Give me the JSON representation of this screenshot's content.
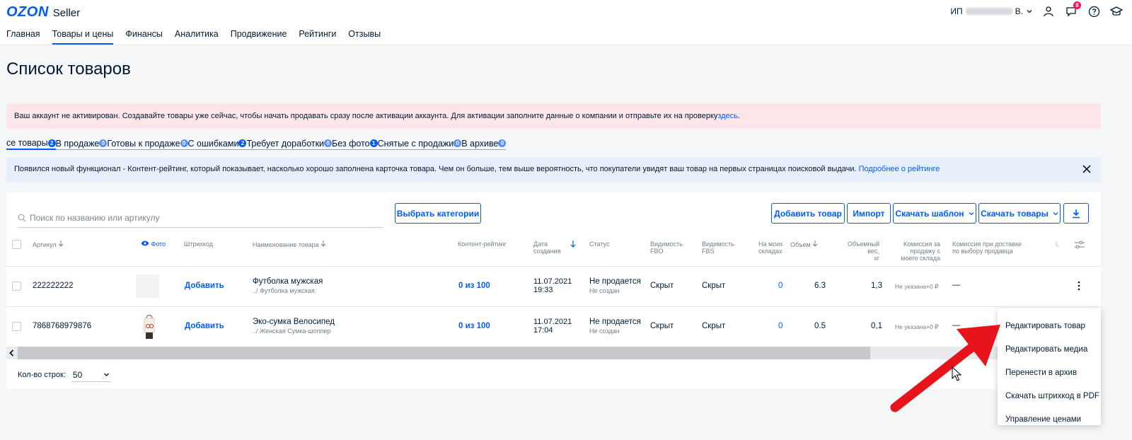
{
  "header": {
    "logo_brand": "OZON",
    "logo_product": "Seller",
    "account_prefix": "ИП",
    "account_suffix": "В.",
    "notifications_count": "8",
    "nav": [
      "Главная",
      "Товары и цены",
      "Финансы",
      "Аналитика",
      "Продвижение",
      "Рейтинги",
      "Отзывы"
    ]
  },
  "page_title": "Список товаров",
  "alert_activation": {
    "text": "Ваш аккаунт не активирован. Создавайте товары уже сейчас, чтобы начать продавать сразу после активации аккаунта. Для активации заполните данные о компании и отправьте их на проверку",
    "link": "здесь",
    "after": "."
  },
  "filter_tabs": [
    {
      "label": "се товары",
      "count": "2"
    },
    {
      "label": "В продаже",
      "count": "0"
    },
    {
      "label": "Готовы к продаже",
      "count": "0"
    },
    {
      "label": "С ошибками",
      "count": "2"
    },
    {
      "label": "Требует доработки",
      "count": "0"
    },
    {
      "label": "Без фото",
      "count": "1"
    },
    {
      "label": "Снятые с продажи",
      "count": "0"
    },
    {
      "label": "В архиве",
      "count": "0"
    }
  ],
  "alert_info": {
    "text": "Появился новый функционал - Контент-рейтинг, который показывает, насколько хорошо заполнена карточка товара. Чем он больше, тем выше вероятность, что покупатели увидят ваш товар на первых страницах поисковой выдачи.",
    "link": "Подробнее о рейтинге"
  },
  "toolbar": {
    "search_placeholder": "Поиск по названию или артикулу",
    "choose_categories": "Выбрать категории",
    "add_product": "Добавить товар",
    "import": "Импорт",
    "download_template": "Скачать шаблон",
    "download_products": "Скачать товары"
  },
  "columns": {
    "article": "Артикул",
    "photo": "Фото",
    "barcode": "Штрихкод",
    "name": "Наименование товара",
    "content_rating": "Контент-рейтинг",
    "created_1": "Дата",
    "created_2": "создания",
    "status": "Статус",
    "vis_fbo_1": "Видимость",
    "vis_fbo_2": "FBO",
    "vis_fbs_1": "Видимость",
    "vis_fbs_2": "FBS",
    "my_wh_1": "На моих",
    "my_wh_2": "складах",
    "volume": "Объем",
    "vol_weight_1": "Объемный вес,",
    "vol_weight_2": "кг",
    "commission_1": "Комиссия за",
    "commission_2": "продажу с",
    "commission_3": "моего склада",
    "delivery_1": "Комиссия при доставке",
    "delivery_2": "по выбору продавца",
    "cut": "L"
  },
  "rows": [
    {
      "article": "222222222",
      "barcode": "Добавить",
      "name": "Футболка мужская",
      "category": "../ Футболка мужская",
      "rating": "0 из 100",
      "date": "11.07.2021",
      "time": "19:33",
      "status": "Не продается",
      "status_sub": "Не создан",
      "fbo": "Скрыт",
      "fbs": "Скрыт",
      "my_wh": "0",
      "volume": "6.3",
      "vol_weight": "1,3",
      "commission": "Не указана+0 ₽",
      "delivery": "—"
    },
    {
      "article": "7868768979876",
      "barcode": "Добавить",
      "name": "Эко-сумка Велосипед",
      "category": "../ Женская Сумка-шоппер",
      "rating": "0 из 100",
      "date": "11.07.2021",
      "time": "17:04",
      "status": "Не продается",
      "status_sub": "Не создан",
      "fbo": "Скрыт",
      "fbs": "Скрыт",
      "my_wh": "0",
      "volume": "0.5",
      "vol_weight": "0,1",
      "commission": "Не указана+0 ₽",
      "delivery": "—"
    }
  ],
  "pagination": {
    "label": "Кол-во строк:",
    "value": "50"
  },
  "context_menu": [
    "Редактировать товар",
    "Редактировать медиа",
    "Перенести в архив",
    "Скачать штрихкод в PDF",
    "Управление ценами"
  ],
  "colors": {
    "brand": "#005bff",
    "alert_red": "#fde6ea",
    "alert_blue": "#e7effd",
    "annotation_arrow": "#e8141b"
  }
}
